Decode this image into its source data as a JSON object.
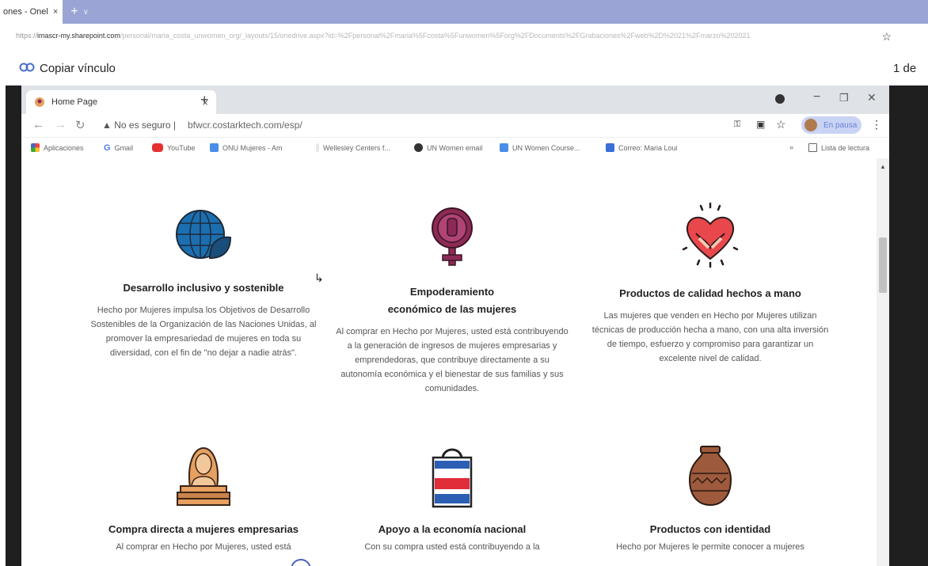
{
  "outer_browser": {
    "tab_title": "ones - Onel",
    "tab_close": "×",
    "new_tab": "+",
    "tab_menu": "∨",
    "url_prefix": "https://",
    "url_domain": "imascr-my.sharepoint.com",
    "url_rest": "/personal/maria_costa_unwomen_org/_layouts/15/onedrive.aspx?id=%2Fpersonal%2Fmaria%5Fcosta%5Funwomen%5Forg%2FDocuments%2FGrabaciones%2Fweb%2D%2021%2Fmarzo%202021",
    "share_label": "Copiar vínculo",
    "page_indicator": "1 de"
  },
  "inner_browser": {
    "tab_title": "Home Page",
    "tab_close": "×",
    "new_tab": "+",
    "not_secure": "No es seguro",
    "url": "bfwcr.costarktech.com/esp/",
    "pause_label": "En pausa",
    "bookmarks": {
      "apps": "Aplicaciones",
      "gmail": "Gmail",
      "youtube": "YouTube",
      "onu": "ONU Mujeres - Am",
      "wellesley": "Wellesley Centers f...",
      "unwomen_email": "UN Women email",
      "unwomen_course": "UN Women Course...",
      "correo": "Correo: Maria Loui",
      "more": "»",
      "reading_list": "Lista de lectura"
    }
  },
  "colors": {
    "globe": "#1b6fb0",
    "leaf": "#1a4e7a",
    "venus": "#8c2a55",
    "heart": "#e8474c",
    "sand": "#e6a060",
    "bag_blue": "#2c5fb3",
    "bag_red": "#e12d3a",
    "vase": "#9e5a3c"
  },
  "cards": [
    {
      "icon": "globe-leaf-icon",
      "title": "Desarrollo inclusivo y sostenible",
      "desc": "Hecho por Mujeres impulsa los Objetivos de Desarrollo Sostenibles de la Organización de las Naciones Unidas, al promover la empresariedad de mujeres en toda su diversidad, con el fin de \"no dejar a nadie atrás\"."
    },
    {
      "icon": "venus-fist-icon",
      "title_line1": "Empoderamiento",
      "title_line2": "económico de las mujeres",
      "desc": "Al comprar en Hecho por Mujeres, usted está contribuyendo a la generación de ingresos de mujeres empresarias y emprendedoras, que contribuye directamente a su autonomía económica y el bienestar de sus familias y sus comunidades."
    },
    {
      "icon": "heart-hands-icon",
      "title": "Productos de calidad hechos a mano",
      "desc": "Las mujeres que venden en Hecho por Mujeres utilizan técnicas de producción hecha a mano, con una alta inversión de tiempo, esfuerzo y compromiso para garantizar un excelente nivel de calidad."
    },
    {
      "icon": "woman-laptop-icon",
      "title": "Compra directa a mujeres empresarias",
      "desc": "Al comprar en Hecho por Mujeres, usted está"
    },
    {
      "icon": "shopping-bag-icon",
      "title": "Apoyo a la economía nacional",
      "desc": "Con su compra usted está contribuyendo a la"
    },
    {
      "icon": "clay-vase-icon",
      "title": "Productos con identidad",
      "desc": "Hecho por Mujeres le permite conocer a mujeres"
    }
  ]
}
